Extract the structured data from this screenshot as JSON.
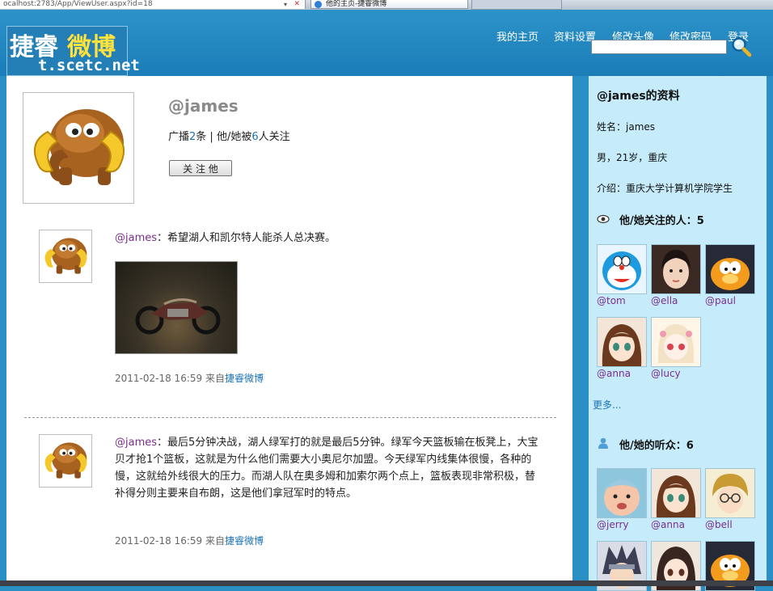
{
  "browser": {
    "address": "ocalhost:2783/App/ViewUser.aspx?id=18",
    "tab_title": "他的主页-捷睿微博"
  },
  "header": {
    "logo_cn_a": "捷睿",
    "logo_cn_b": "微博",
    "logo_en": "t.scetc.net",
    "nav": [
      "我的主页",
      "资料设置",
      "修改头像",
      "修改密码",
      "登录"
    ],
    "search_value": ""
  },
  "profile": {
    "name": "@james",
    "stats_prefix": "广播",
    "broadcast_count": "2",
    "stats_mid": "条 | 他/她被",
    "follower_count": "6",
    "stats_suffix": "人关注",
    "follow_button": "关 注 他"
  },
  "posts": [
    {
      "author": "@james",
      "text": "：希望湖人和凯尔特人能杀人总决赛。",
      "time": "2011-02-18 16:59",
      "source_prefix": "来自",
      "source": "捷睿微博"
    },
    {
      "author": "@james",
      "text": "：最后5分钟决战，湖人绿军打的就是最后5分钟。绿军今天篮板输在板凳上，大宝贝才抢1个篮板，这就是为什么他们需要大小奥尼尔加盟。今天绿军内线集体很慢，各种的慢，这就给外线很大的压力。而湖人队在奥多姆和加索尔两个点上，篮板表现非常积极，替补得分则主要来自布朗，这是他们拿冠军时的特点。",
      "time": "2011-02-18 16:59",
      "source_prefix": "来自",
      "source": "捷睿微博"
    }
  ],
  "sidebar": {
    "title": "@james的资料",
    "name_line": "姓名：james",
    "basic_line": "男，21岁，重庆",
    "intro_line": "介绍：重庆大学计算机学院学生",
    "following_title": "他/她关注的人：5",
    "following": [
      {
        "name": "@tom",
        "icon": "doraemon"
      },
      {
        "name": "@ella",
        "icon": "girl-photo"
      },
      {
        "name": "@paul",
        "icon": "garfield"
      },
      {
        "name": "@anna",
        "icon": "anime-girl-brown"
      },
      {
        "name": "@lucy",
        "icon": "anime-girl-pink"
      }
    ],
    "more": "更多...",
    "listeners_title": "他/她的听众：6",
    "listeners": [
      {
        "name": "@jerry",
        "icon": "baby-photo"
      },
      {
        "name": "@anna",
        "icon": "anime-girl-brown"
      },
      {
        "name": "@bell",
        "icon": "anime-boy-glasses"
      },
      {
        "name": "",
        "icon": "anime-ninja"
      },
      {
        "name": "",
        "icon": "anime-girl-dark"
      },
      {
        "name": "",
        "icon": "garfield"
      }
    ]
  },
  "colors": {
    "header_blue": "#1c7db8",
    "sidebar_bg": "#c6ecfb",
    "link_blue": "#1a72b8",
    "author_purple": "#7b2d8b"
  }
}
